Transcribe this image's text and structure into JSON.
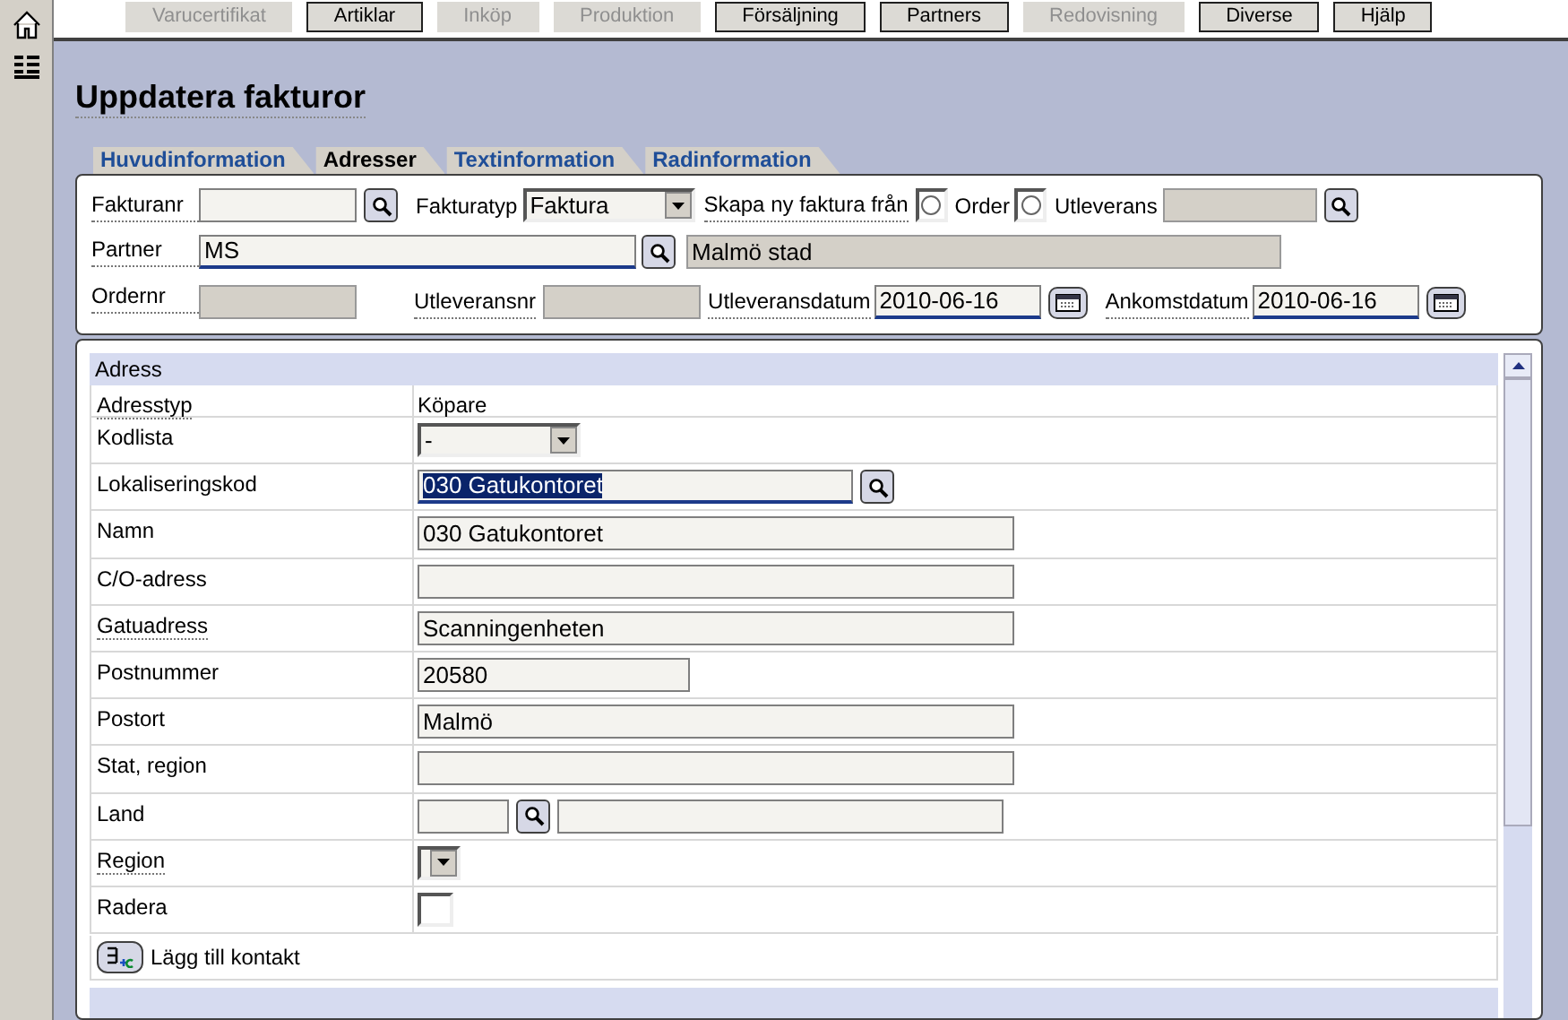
{
  "menu": [
    {
      "label": "Varucertifikat",
      "disabled": true
    },
    {
      "label": "Artiklar",
      "disabled": false
    },
    {
      "label": "Inköp",
      "disabled": true
    },
    {
      "label": "Produktion",
      "disabled": true
    },
    {
      "label": "Försäljning",
      "disabled": false
    },
    {
      "label": "Partners",
      "disabled": false
    },
    {
      "label": "Redovisning",
      "disabled": true
    },
    {
      "label": "Diverse",
      "disabled": false
    },
    {
      "label": "Hjälp",
      "disabled": false
    }
  ],
  "title": "Uppdatera fakturor",
  "tabs": [
    {
      "label": "Huvudinformation",
      "selected": false
    },
    {
      "label": "Adresser",
      "selected": true
    },
    {
      "label": "Textinformation",
      "selected": false
    },
    {
      "label": "Radinformation",
      "selected": false
    }
  ],
  "header": {
    "invoice_no": {
      "label": "Fakturanr"
    },
    "invoice_type": {
      "label": "Fakturatyp",
      "value": "Faktura"
    },
    "create_from": {
      "label": "Skapa ny faktura från",
      "options": [
        {
          "label": "Order",
          "selected": false
        },
        {
          "label": "Utleverans",
          "selected": false
        }
      ]
    },
    "partner": {
      "label": "Partner",
      "value": "MS",
      "name": "Malmö stad"
    },
    "order_no": {
      "label": "Ordernr"
    },
    "delivery_no": {
      "label": "Utleveransnr"
    },
    "delivery_date": {
      "label": "Utleveransdatum",
      "value": "2010-06-16"
    },
    "arrival_date": {
      "label": "Ankomstdatum",
      "value": "2010-06-16"
    }
  },
  "address": {
    "title": "Adress",
    "rows": [
      {
        "kind": "text",
        "label": "Adresstyp",
        "dotted": true,
        "value": "Köpare"
      },
      {
        "kind": "select",
        "label": "Kodlista",
        "dotted": false,
        "value": "-"
      },
      {
        "kind": "lookup",
        "label": "Lokaliseringskod",
        "dotted": false,
        "value": "030 Gatukontoret",
        "highlighted": true
      },
      {
        "kind": "field",
        "label": "Namn",
        "dotted": false,
        "value": "030 Gatukontoret"
      },
      {
        "kind": "field",
        "label": "C/O-adress",
        "dotted": false
      },
      {
        "kind": "field",
        "label": "Gatuadress",
        "dotted": true,
        "value": "Scanningenheten"
      },
      {
        "kind": "short",
        "label": "Postnummer",
        "dotted": false,
        "value": "20580"
      },
      {
        "kind": "field",
        "label": "Postort",
        "dotted": false,
        "value": "Malmö"
      },
      {
        "kind": "field",
        "label": "Stat, region",
        "dotted": false
      },
      {
        "kind": "country",
        "label": "Land",
        "dotted": false
      },
      {
        "kind": "tiny_select",
        "label": "Region",
        "dotted": true
      },
      {
        "kind": "checkbox",
        "label": "Radera",
        "dotted": false,
        "checked": false
      }
    ],
    "add_contact": "Lägg till kontakt"
  }
}
